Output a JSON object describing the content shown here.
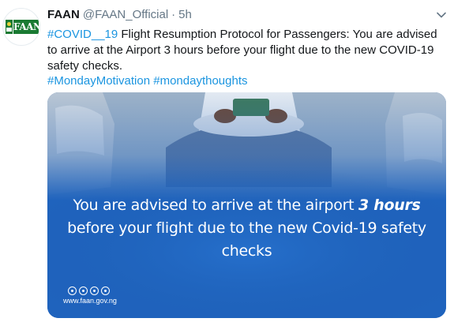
{
  "account": {
    "logo_text": "FAAN",
    "name": "FAAN",
    "handle": "@FAAN_Official",
    "separator": "·",
    "time": "5h"
  },
  "tweet": {
    "hashtag_covid": "#COVID__19",
    "body": " Flight Resumption Protocol for Passengers: You are advised to arrive at the Airport 3 hours before your flight due to the new COVID-19 safety checks.",
    "hashtag_monday_motivation": "#MondayMotivation",
    "hashtag_monday_thoughts": "#mondaythoughts"
  },
  "media": {
    "caption_part1": "You are advised to arrive at the airport ",
    "caption_bold": "3 hours",
    "caption_part2": " before your flight due to the new Covid-19 safety checks",
    "website": "www.faan.gov.ng",
    "social_icons": [
      "twitter-icon",
      "instagram-icon",
      "facebook-icon",
      "youtube-icon"
    ]
  },
  "colors": {
    "link": "#1b95e0",
    "secondary_text": "#657786",
    "primary_text": "#14171a",
    "media_blue": "#1f63bd",
    "brand_green": "#1a7a32"
  },
  "icons": {
    "caret": "chevron-down-icon"
  }
}
